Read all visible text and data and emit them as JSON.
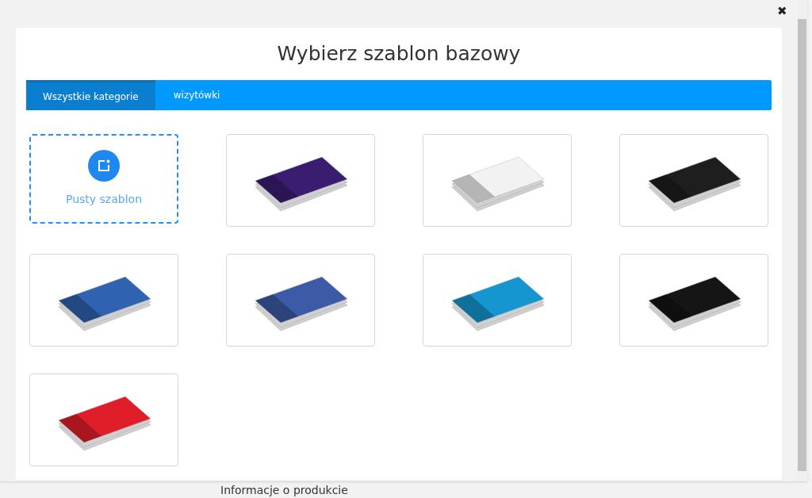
{
  "dialog": {
    "title": "Wybierz szablon bazowy",
    "close": "✖"
  },
  "tabs": [
    {
      "label": "Wszystkie kategorie",
      "selected": true
    },
    {
      "label": "wizytówki",
      "selected": false
    }
  ],
  "templates": [
    {
      "kind": "blank",
      "label": "Pusty szablon"
    },
    {
      "kind": "card",
      "color": "#3a1d70"
    },
    {
      "kind": "card",
      "color": "#f2f2f2"
    },
    {
      "kind": "card",
      "color": "#1e1e1e"
    },
    {
      "kind": "card",
      "color": "#2f62b0"
    },
    {
      "kind": "card",
      "color": "#3c5aa6"
    },
    {
      "kind": "card",
      "color": "#1596d0"
    },
    {
      "kind": "card",
      "color": "#151515"
    },
    {
      "kind": "card",
      "color": "#e01e2a"
    }
  ],
  "background_page": {
    "heading": "Informacje o produkcie"
  }
}
